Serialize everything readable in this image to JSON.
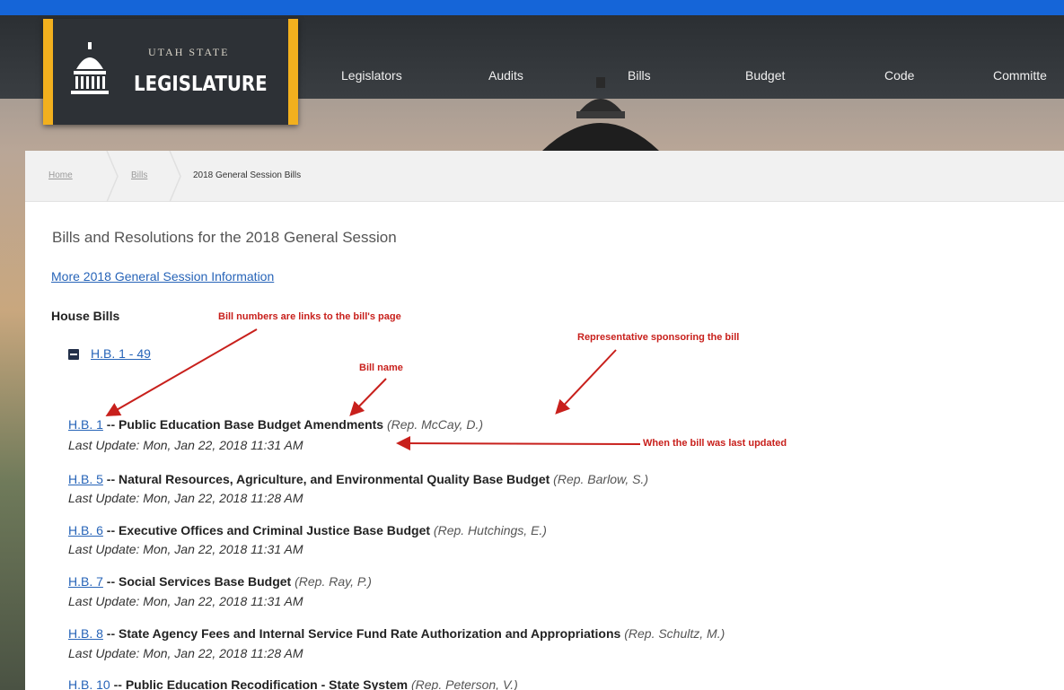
{
  "header": {
    "logo": {
      "line1": "UTAH STATE",
      "line2": "LEGISLATURE"
    },
    "nav": [
      "Legislators",
      "Audits",
      "Bills",
      "Budget",
      "Code",
      "Committe"
    ]
  },
  "breadcrumb": [
    "Home",
    "Bills",
    "2018 General Session Bills"
  ],
  "page": {
    "heading": "Bills and Resolutions for the 2018 General Session",
    "more_link": "More 2018 General Session Information",
    "house_label": "House Bills",
    "range_label": "H.B. 1 - 49"
  },
  "bills": [
    {
      "num": "H.B. 1",
      "name": "Public Education Base Budget Amendments",
      "rep": "(Rep. McCay, D.)",
      "update": "Last Update: Mon, Jan 22, 2018 11:31 AM"
    },
    {
      "num": "H.B. 5",
      "name": "Natural Resources, Agriculture, and Environmental Quality Base Budget",
      "rep": "(Rep. Barlow, S.)",
      "update": "Last Update: Mon, Jan 22, 2018 11:28 AM"
    },
    {
      "num": "H.B. 6",
      "name": "Executive Offices and Criminal Justice Base Budget",
      "rep": "(Rep. Hutchings, E.)",
      "update": "Last Update: Mon, Jan 22, 2018 11:31 AM"
    },
    {
      "num": "H.B. 7",
      "name": "Social Services Base Budget",
      "rep": "(Rep. Ray, P.)",
      "update": "Last Update: Mon, Jan 22, 2018 11:31 AM"
    },
    {
      "num": "H.B. 8",
      "name": "State Agency Fees and Internal Service Fund Rate Authorization and Appropriations",
      "rep": "(Rep. Schultz, M.)",
      "update": "Last Update: Mon, Jan 22, 2018 11:28 AM"
    },
    {
      "num": "H.B. 10",
      "name": "Public Education Recodification - State System",
      "rep": "(Rep. Peterson, V.)",
      "update": ""
    }
  ],
  "annotations": {
    "links": "Bill numbers are links to the bill's page",
    "sponsor": "Representative sponsoring the bill",
    "name": "Bill name",
    "updated": "When the bill was last updated"
  },
  "colors": {
    "accent_blue": "#1565d8",
    "logo_gold": "#f2b01e",
    "link": "#2764b8",
    "annotation_red": "#c8201c"
  }
}
